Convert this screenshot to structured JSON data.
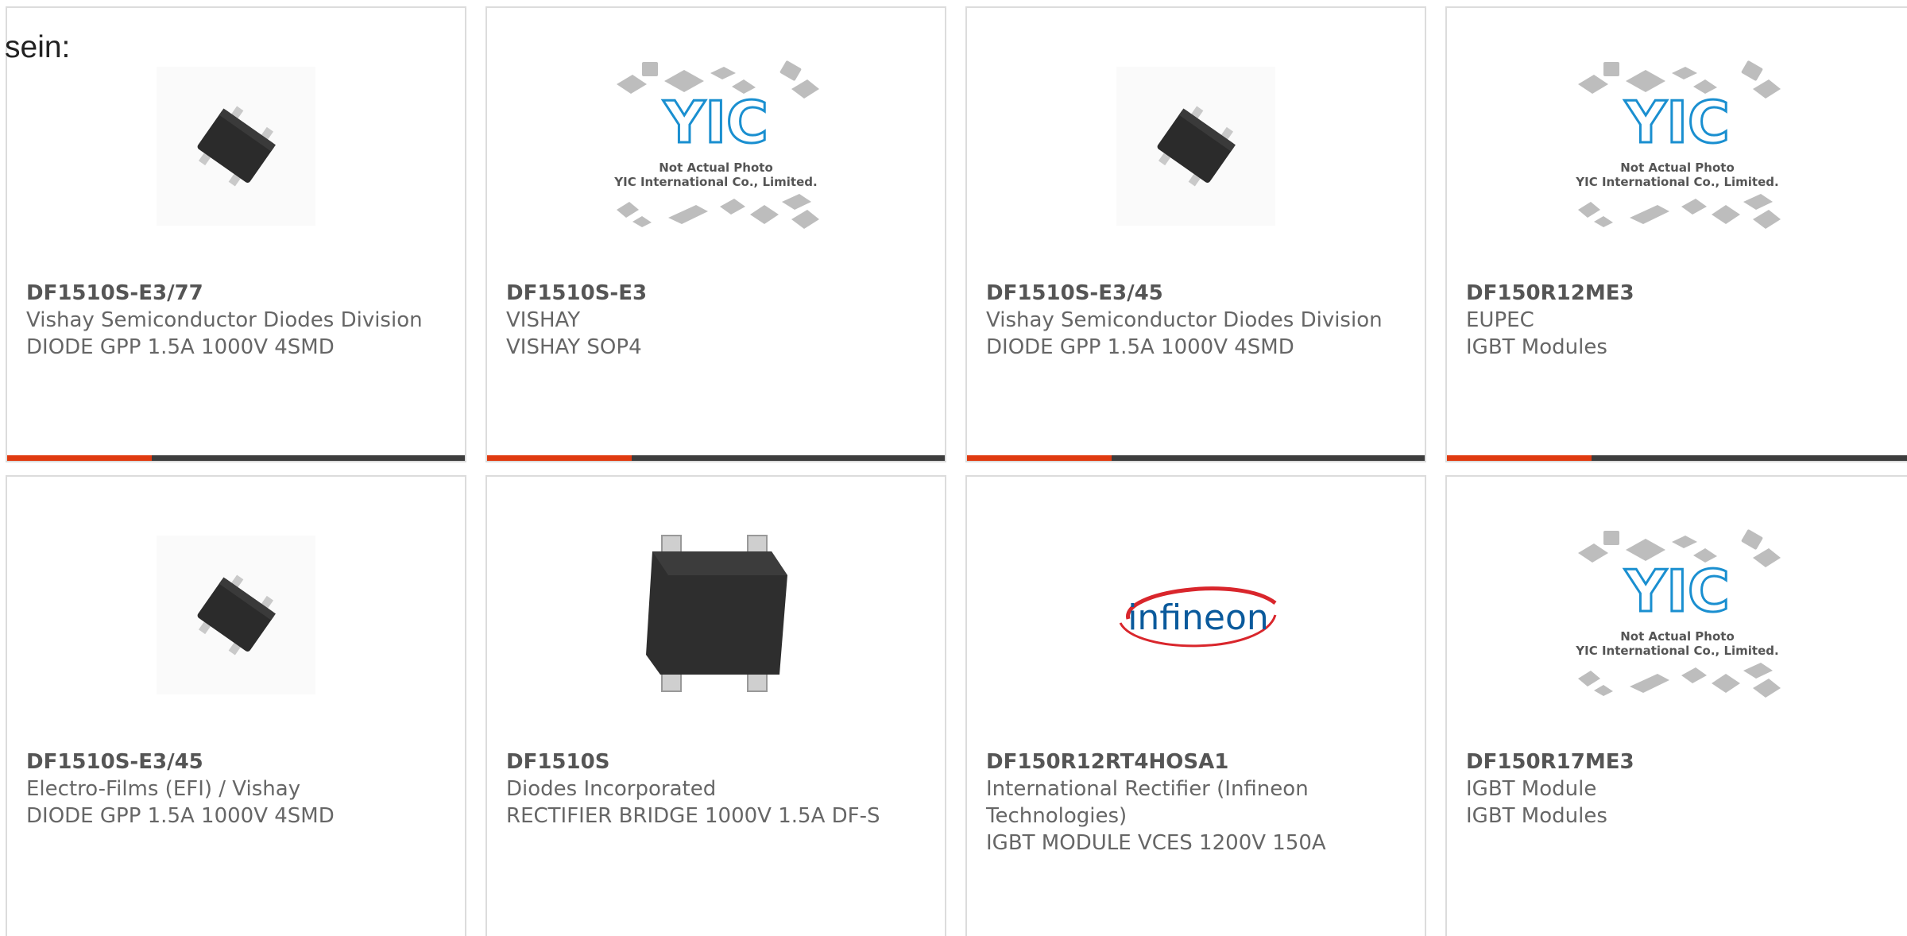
{
  "lead_text": "sein:",
  "colors": {
    "accent_bar": "#e03a10",
    "dark_bar": "#3d3d3d",
    "card_border": "#dcdcdc",
    "logo_blue": "#1a8fd0",
    "infineon_red": "#d9262c"
  },
  "cards": [
    {
      "part": "DF1510S-E3/77",
      "maker": "Vishay Semiconductor Diodes Division",
      "desc": "DIODE GPP 1.5A 1000V 4SMD",
      "image": "smd-chip-icon"
    },
    {
      "part": "DF1510S-E3",
      "maker": "VISHAY",
      "desc": "VISHAY SOP4",
      "image": "yic-placeholder",
      "placeholder_logo": "YIC",
      "placeholder_line1": "Not Actual Photo",
      "placeholder_line2": "YIC International Co., Limited."
    },
    {
      "part": "DF1510S-E3/45",
      "maker": "Vishay Semiconductor Diodes Division",
      "desc": "DIODE GPP 1.5A 1000V 4SMD",
      "image": "smd-chip-icon"
    },
    {
      "part": "DF150R12ME3",
      "maker": "EUPEC",
      "desc": "IGBT Modules",
      "image": "yic-placeholder",
      "placeholder_logo": "YIC",
      "placeholder_line1": "Not Actual Photo",
      "placeholder_line2": "YIC International Co., Limited."
    },
    {
      "part": "DF1510S-E3/45",
      "maker": "Electro-Films (EFI) / Vishay",
      "desc": "DIODE GPP 1.5A 1000V 4SMD",
      "image": "smd-chip-icon"
    },
    {
      "part": "DF1510S",
      "maker": "Diodes Incorporated",
      "desc": "RECTIFIER BRIDGE 1000V 1.5A DF-S",
      "image": "bridge-rectifier-icon"
    },
    {
      "part": "DF150R12RT4HOSA1",
      "maker": "International Rectifier (Infineon Technologies)",
      "desc": "IGBT MODULE VCES 1200V 150A",
      "image": "infineon-logo",
      "logo_text": "infineon"
    },
    {
      "part": "DF150R17ME3",
      "maker": "IGBT Module",
      "desc": "IGBT Modules",
      "image": "yic-placeholder",
      "placeholder_logo": "YIC",
      "placeholder_line1": "Not Actual Photo",
      "placeholder_line2": "YIC International Co., Limited."
    }
  ]
}
